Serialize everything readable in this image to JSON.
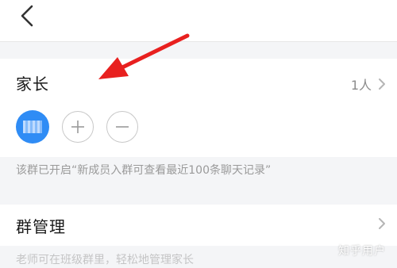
{
  "topbar": {
    "back_icon": "chevron-left-icon"
  },
  "parents": {
    "title": "家长",
    "count": "1人",
    "chevron_icon": "chevron-right-icon",
    "avatar_icon": "avatar-blurred",
    "add_icon": "plus-icon",
    "remove_icon": "minus-icon",
    "avatar_color": "#2f8cf5"
  },
  "notice": "该群已开启“新成员入群可查看最近100条聊天记录”",
  "group_manage": {
    "title": "群管理",
    "chevron_icon": "chevron-right-icon"
  },
  "partial_hint": "老师可在班级群里，轻松地管理家长",
  "annotation": {
    "arrow_color": "#e8201f"
  },
  "watermark": "知乎用户"
}
